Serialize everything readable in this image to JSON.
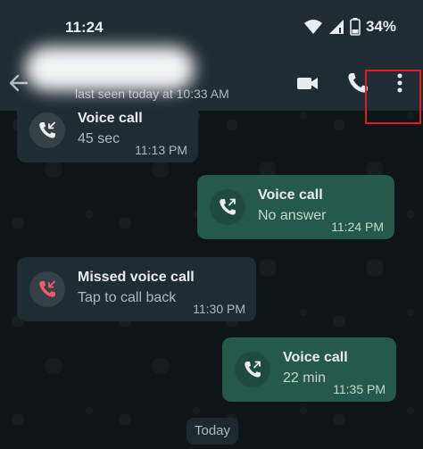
{
  "status_bar": {
    "time": "11:24",
    "battery_percent": "34%",
    "icons": [
      "wifi-icon",
      "signal-icon",
      "battery-icon"
    ]
  },
  "header": {
    "last_seen": "last seen today at 10:33 AM",
    "actions": [
      "video-call-icon",
      "voice-call-icon",
      "more-options-icon"
    ]
  },
  "messages": [
    {
      "direction": "in",
      "title": "Voice call",
      "subtitle": "45 sec",
      "time": "11:13 PM",
      "icon": "incoming-call-icon"
    },
    {
      "direction": "out",
      "title": "Voice call",
      "subtitle": "No answer",
      "time": "11:24 PM",
      "icon": "outgoing-call-icon"
    },
    {
      "direction": "in",
      "title": "Missed voice call",
      "subtitle": "Tap to call back",
      "time": "11:30 PM",
      "icon": "missed-call-icon"
    },
    {
      "direction": "out",
      "title": "Voice call",
      "subtitle": "22 min",
      "time": "11:35 PM",
      "icon": "outgoing-call-icon"
    }
  ],
  "date_divider": "Today",
  "colors": {
    "header_bg": "#1f2c33",
    "incoming_bubble": "#202c33",
    "outgoing_bubble": "#25594a",
    "missed_call_icon": "#f15c6d",
    "highlight_border": "#e01b24"
  }
}
